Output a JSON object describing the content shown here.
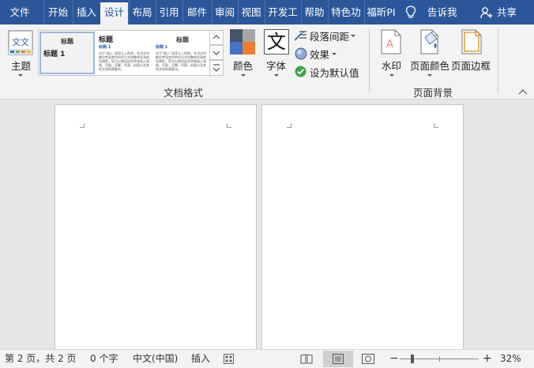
{
  "tabs": [
    {
      "label": "文件"
    },
    {
      "label": "开始"
    },
    {
      "label": "插入"
    },
    {
      "label": "设计",
      "active": true
    },
    {
      "label": "布局"
    },
    {
      "label": "引用"
    },
    {
      "label": "邮件"
    },
    {
      "label": "审阅"
    },
    {
      "label": "视图"
    },
    {
      "label": "开发工"
    },
    {
      "label": "帮助"
    },
    {
      "label": "特色功"
    },
    {
      "label": "福昕PI"
    }
  ],
  "tell_me": {
    "label": "告诉我",
    "icon": "lightbulb-icon"
  },
  "share": {
    "label": "共享",
    "icon": "share-person-icon"
  },
  "ribbon": {
    "theme_label": "主题",
    "theme_icon_text": "文文",
    "style_gallery": {
      "items": [
        {
          "title": "标题",
          "heading": "标题 1",
          "body": ""
        },
        {
          "title": "标题",
          "subtitle": "标题 1",
          "body": "对于“插入”选项卡上的库，在设计时都应考虑其中的项与文档整体外观的协调性。您可以使用这些库来插入表格、页眉、页脚、列表、封面以及其他文档构建基块。"
        },
        {
          "title": "标题",
          "subtitle": "标题 1",
          "body": "对于“插入”选项卡上的库，在设计时都应考虑其中的项与文档整体外观的协调性。您可以使用这些库来插入表格、页眉、页脚、列表、封面以及其他文档构建基块。"
        }
      ]
    },
    "colors_label": "颜色",
    "fonts_label": "字体",
    "fonts_icon_text": "文",
    "paragraph_spacing_label": "段落间距",
    "effects_label": "效果",
    "set_default_label": "设为默认值",
    "doc_format_group_label": "文档格式",
    "watermark_label": "水印",
    "page_color_label": "页面颜色",
    "page_borders_label": "页面边框",
    "page_background_group_label": "页面背景",
    "colors_swatch": [
      "#44546a",
      "#a5a5a5",
      "#4472c4",
      "#ed7d31"
    ]
  },
  "status": {
    "page": "第 2 页，共 2 页",
    "words": "0 个字",
    "language": "中文(中国)",
    "mode": "插入",
    "zoom": "32%",
    "zoom_fraction": 0.32
  },
  "colors": {
    "accent": "#2b579a"
  }
}
